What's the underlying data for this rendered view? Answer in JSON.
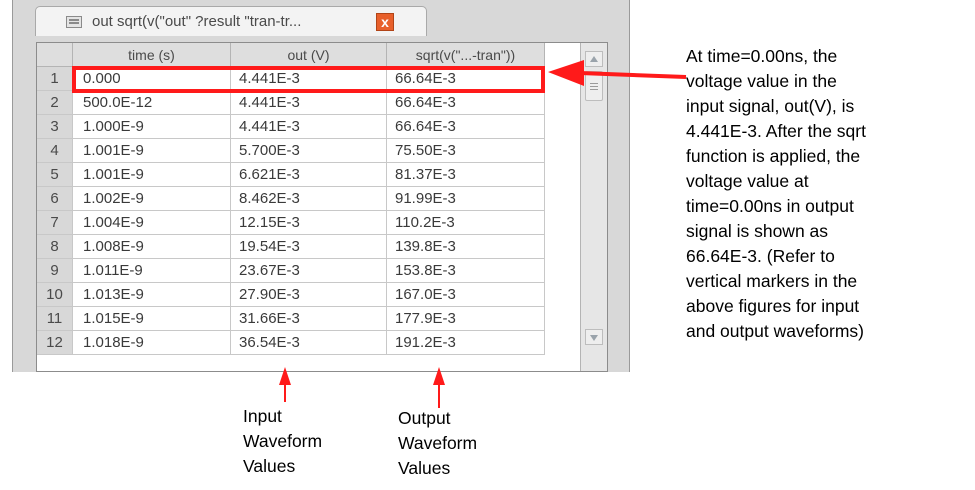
{
  "tab": {
    "title": "out sqrt(v(\"out\" ?result \"tran-tr...",
    "close": "x"
  },
  "table": {
    "headers": [
      "time (s)",
      "out (V)",
      "sqrt(v(\"...-tran\"))"
    ],
    "rows": [
      [
        "1",
        "0.000",
        "4.441E-3",
        "66.64E-3"
      ],
      [
        "2",
        "500.0E-12",
        "4.441E-3",
        "66.64E-3"
      ],
      [
        "3",
        "1.000E-9",
        "4.441E-3",
        "66.64E-3"
      ],
      [
        "4",
        "1.001E-9",
        "5.700E-3",
        "75.50E-3"
      ],
      [
        "5",
        "1.001E-9",
        "6.621E-3",
        "81.37E-3"
      ],
      [
        "6",
        "1.002E-9",
        "8.462E-3",
        "91.99E-3"
      ],
      [
        "7",
        "1.004E-9",
        "12.15E-3",
        "110.2E-3"
      ],
      [
        "8",
        "1.008E-9",
        "19.54E-3",
        "139.8E-3"
      ],
      [
        "9",
        "1.011E-9",
        "23.67E-3",
        "153.8E-3"
      ],
      [
        "10",
        "1.013E-9",
        "27.90E-3",
        "167.0E-3"
      ],
      [
        "11",
        "1.015E-9",
        "31.66E-3",
        "177.9E-3"
      ],
      [
        "12",
        "1.018E-9",
        "36.54E-3",
        "191.2E-3"
      ]
    ]
  },
  "annotation": "At time=0.00ns, the\nvoltage value in the\ninput signal, out(V), is\n4.441E-3. After the sqrt\nfunction is applied, the\nvoltage value at\ntime=0.00ns in output\nsignal is shown as\n66.64E-3. (Refer to\nvertical markers in the\nabove figures for input\nand output waveforms)",
  "captions": {
    "input": "Input\nWaveform\nValues",
    "output": "Output\nWaveform\nValues"
  },
  "colors": {
    "highlight": "#ff1a1a",
    "tab_close": "#e8602b"
  }
}
